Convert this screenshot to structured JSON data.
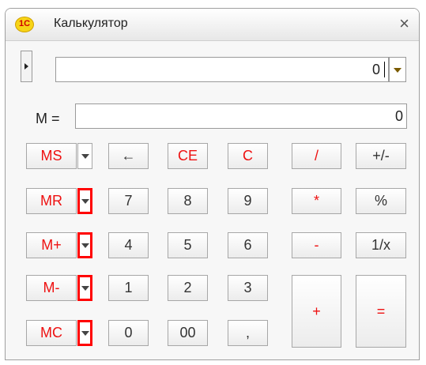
{
  "window": {
    "title": "Калькулятор",
    "logo": "1С",
    "close_label": "×"
  },
  "display": {
    "value": "0"
  },
  "memory": {
    "label": "M =",
    "value": "0"
  },
  "buttons": {
    "ms": "MS",
    "back": "←",
    "ce": "CE",
    "c": "C",
    "div": "/",
    "plusminus": "+/-",
    "mr": "MR",
    "d7": "7",
    "d8": "8",
    "d9": "9",
    "mul": "*",
    "percent": "%",
    "mplus": "M+",
    "d4": "4",
    "d5": "5",
    "d6": "6",
    "minus": "-",
    "recip": "1/x",
    "mminus": "M-",
    "d1": "1",
    "d2": "2",
    "d3": "3",
    "plus": "+",
    "equals": "=",
    "mc": "MC",
    "d0": "0",
    "d00": "00",
    "dot": ","
  },
  "colors": {
    "accent": "#ff0000",
    "border": "#a7a7a7"
  }
}
